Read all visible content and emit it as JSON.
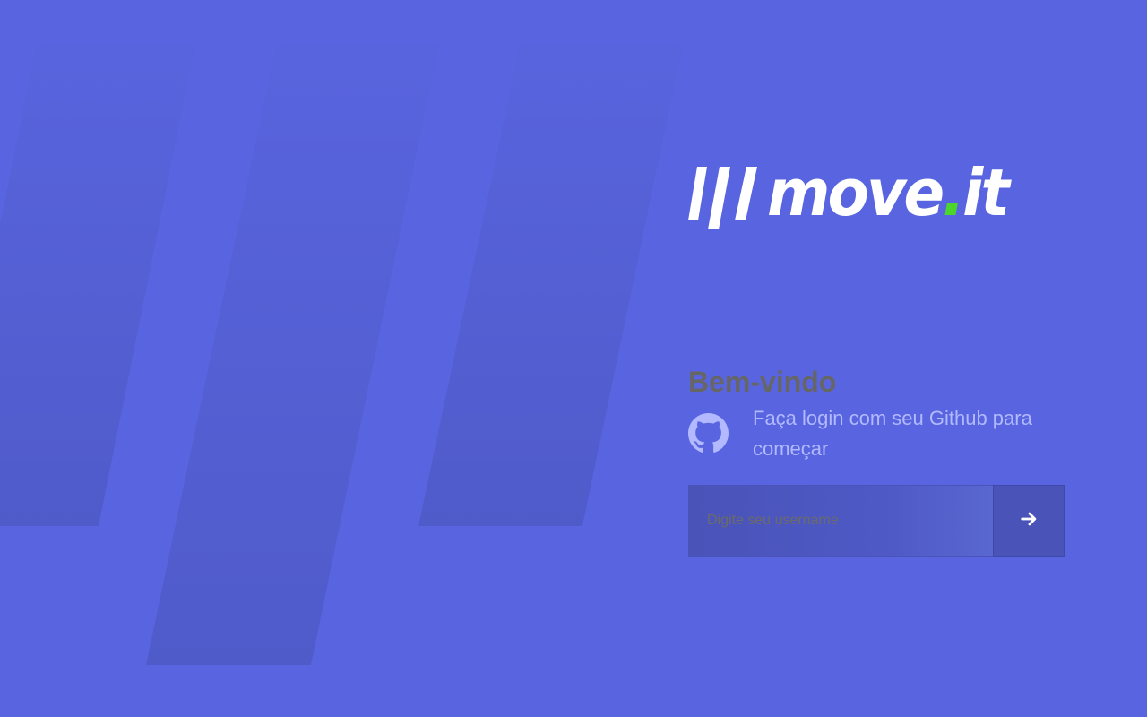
{
  "logo": {
    "text_main": "move",
    "text_dot": ".",
    "text_suffix": "it",
    "dot_color": "#4CD62B"
  },
  "login": {
    "title": "Bem-vindo",
    "github_message": "Faça login com seu Github para começar",
    "username_placeholder": "Digite seu username",
    "username_value": "",
    "submit_icon": "arrow-right-icon"
  },
  "colors": {
    "background": "#5965E0",
    "input_background": "#4953B8",
    "title_text": "#666666",
    "subtitle_text": "#B2B9FF",
    "decor_stripes": "#4953B8"
  }
}
